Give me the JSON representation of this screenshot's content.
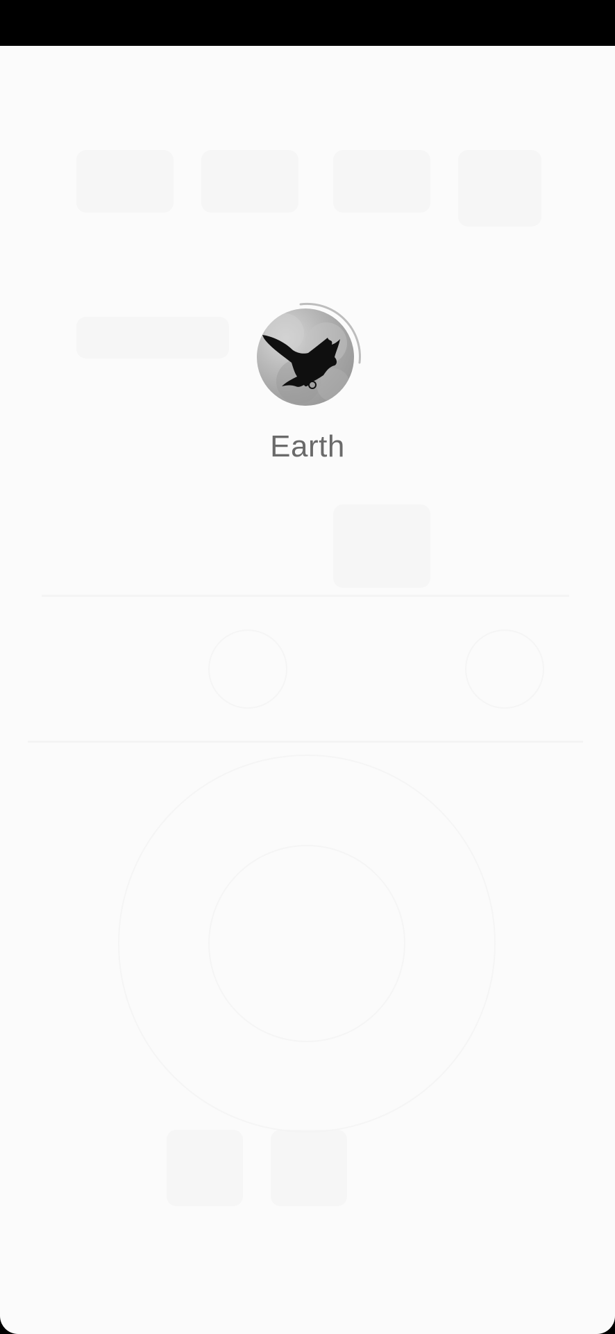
{
  "splash": {
    "app_name": "Earth",
    "logo_icon": "bird-silhouette-icon",
    "loading_indicator": "progress-arc-icon"
  },
  "colors": {
    "status_bar": "#000000",
    "surface": "#fbfbfb",
    "app_name_text": "#6a6a6a",
    "arc": "#bdbdbd"
  }
}
